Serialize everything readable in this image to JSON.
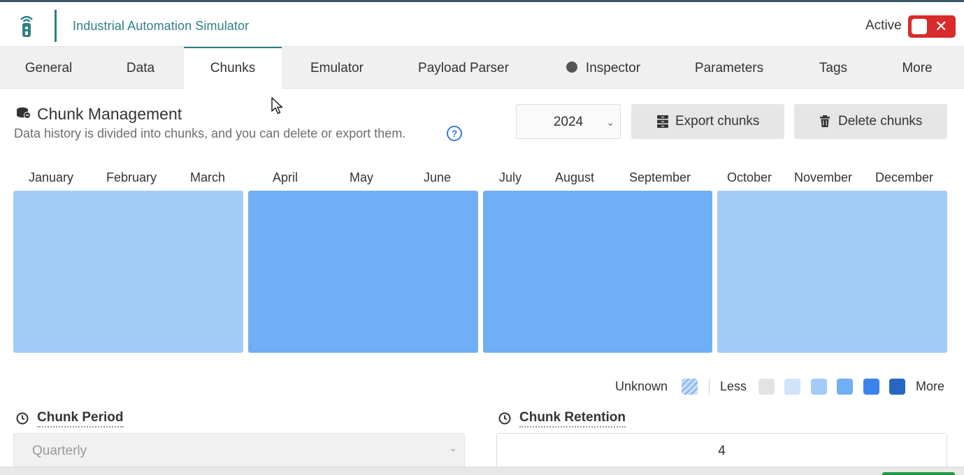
{
  "header": {
    "app_title": "Industrial Automation Simulator",
    "active_label": "Active",
    "toggle_state": "off",
    "toggle_close_glyph": "✕"
  },
  "tabs": [
    {
      "label": "General",
      "active": false
    },
    {
      "label": "Data",
      "active": false
    },
    {
      "label": "Chunks",
      "active": true
    },
    {
      "label": "Emulator",
      "active": false
    },
    {
      "label": "Payload Parser",
      "active": false
    },
    {
      "label": "Inspector",
      "active": false
    },
    {
      "label": "Parameters",
      "active": false
    },
    {
      "label": "Tags",
      "active": false
    },
    {
      "label": "More",
      "active": false
    }
  ],
  "section": {
    "title": "Chunk Management",
    "subtitle": "Data history is divided into chunks, and you can delete or export them.",
    "help_glyph": "?"
  },
  "controls": {
    "year": "2024",
    "export_label": "Export chunks",
    "delete_label": "Delete chunks"
  },
  "months": [
    "January",
    "February",
    "March",
    "April",
    "May",
    "June",
    "July",
    "August",
    "September",
    "October",
    "November",
    "December"
  ],
  "quarters": [
    {
      "months": "January–March",
      "level": 2,
      "color": "#a3cbf8"
    },
    {
      "months": "April–June",
      "level": 3,
      "color": "#70aef6"
    },
    {
      "months": "July–September",
      "level": 3,
      "color": "#70aef6"
    },
    {
      "months": "October–December",
      "level": 2,
      "color": "#a3cbf8"
    }
  ],
  "legend": {
    "unknown_label": "Unknown",
    "less_label": "Less",
    "more_label": "More",
    "scale_colors": [
      "#e3e3e3",
      "#cfe3fb",
      "#a3cbf8",
      "#70aef6",
      "#3b83ec",
      "#2866c4"
    ]
  },
  "fields": {
    "period_label": "Chunk Period",
    "period_value": "Quarterly",
    "retention_label": "Chunk Retention",
    "retention_value": "4"
  }
}
